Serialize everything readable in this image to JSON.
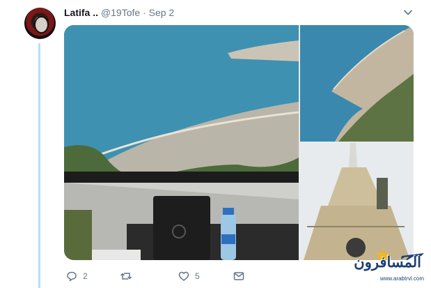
{
  "tweet": {
    "author_name": "Latifa ..",
    "handle": "@19Tofe",
    "separator": "·",
    "date": "Sep 2"
  },
  "actions": {
    "reply_count": "2",
    "retweet_count": "",
    "like_count": "5"
  },
  "watermark": {
    "title": "المسافرون",
    "url": "www.arabtrvl.com"
  },
  "colors": {
    "thread_line": "#b6e0f5",
    "muted_text": "#657786",
    "brand_blue": "#1e3f74"
  }
}
